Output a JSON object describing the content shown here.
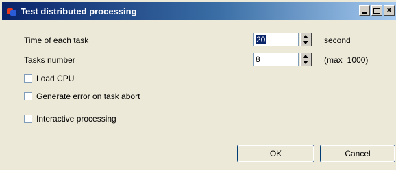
{
  "window": {
    "title": "Test distributed processing"
  },
  "titlebar": {
    "minimize_label": "",
    "maximize_label": "",
    "close_label": "X"
  },
  "fields": {
    "time_label": "Time of each task",
    "time_value": "20",
    "time_suffix": "second",
    "tasks_label": "Tasks number",
    "tasks_value": "8",
    "tasks_suffix": "(max=1000)"
  },
  "options": {
    "load_cpu": "Load CPU",
    "generate_error": "Generate error on task abort",
    "interactive": "Interactive processing"
  },
  "buttons": {
    "ok": "OK",
    "cancel": "Cancel"
  }
}
